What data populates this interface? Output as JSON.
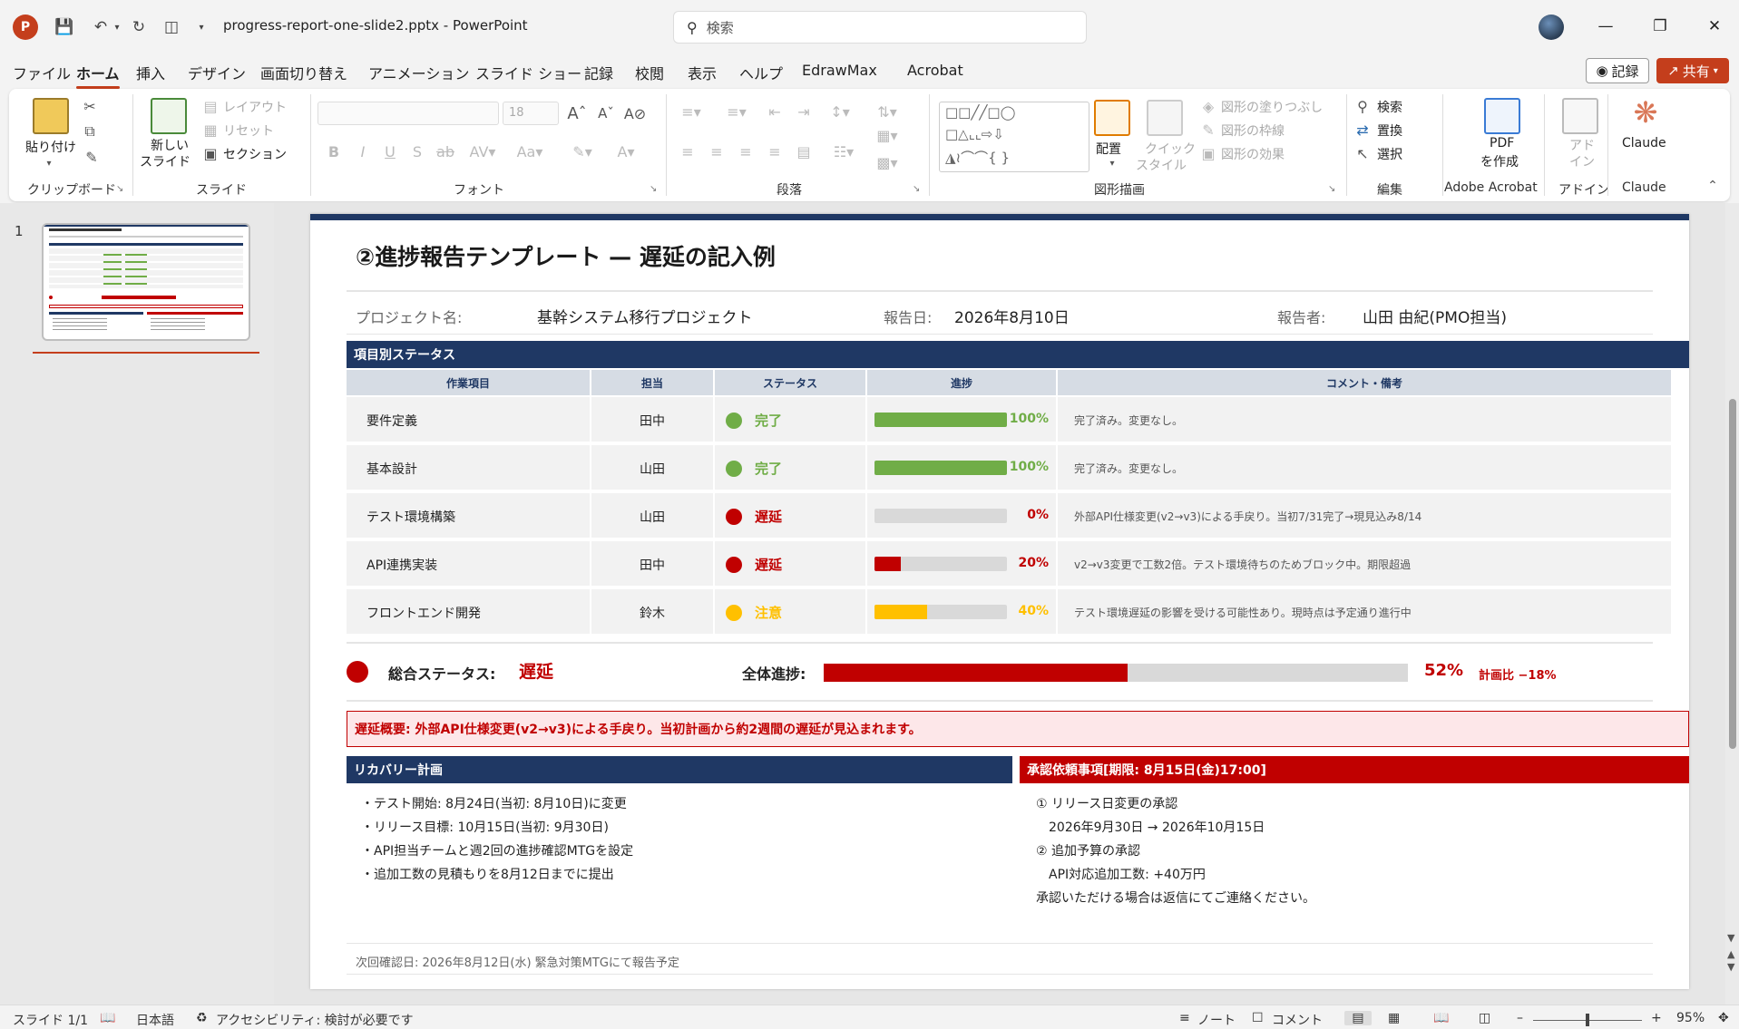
{
  "titlebar": {
    "app_logo": "P",
    "doc_title": "progress-report-one-slide2.pptx  -  PowerPoint",
    "search_placeholder": "検索"
  },
  "menu": {
    "items": [
      "ファイル",
      "ホーム",
      "挿入",
      "デザイン",
      "画面切り替え",
      "アニメーション",
      "スライド ショー",
      "記録",
      "校閲",
      "表示",
      "ヘルプ",
      "EdrawMax",
      "Acrobat"
    ],
    "active": "ホーム",
    "record_btn": "記録",
    "share_btn": "共有"
  },
  "ribbon": {
    "groups": [
      "クリップボード",
      "スライド",
      "フォント",
      "段落",
      "図形描画",
      "編集",
      "Adobe Acrobat",
      "アドイン",
      "Claude"
    ],
    "paste": "貼り付け",
    "new_slide_1": "新しい",
    "new_slide_2": "スライド",
    "layout": "レイアウト",
    "reset": "リセット",
    "section": "セクション",
    "font_size": "18",
    "arrange": "配置",
    "quick_style_1": "クイック",
    "quick_style_2": "スタイル",
    "shape_fill": "図形の塗りつぶし",
    "shape_outline": "図形の枠線",
    "shape_effect": "図形の効果",
    "find": "検索",
    "replace": "置換",
    "select": "選択",
    "pdf_1": "PDF",
    "pdf_2": "を作成",
    "addin_1": "アド",
    "addin_2": "イン",
    "claude": "Claude"
  },
  "thumb": {
    "number": "1"
  },
  "slide": {
    "title": "②進捗報告テンプレート — 遅延の記入例",
    "info": {
      "project_label": "プロジェクト名:",
      "project_value": "基幹システム移行プロジェクト",
      "date_label": "報告日:",
      "date_value": "2026年8月10日",
      "reporter_label": "報告者:",
      "reporter_value": "山田 由紀(PMO担当)"
    },
    "status_section": "項目別ステータス",
    "columns": [
      "作業項目",
      "担当",
      "ステータス",
      "進捗",
      "コメント・備考"
    ],
    "rows": [
      {
        "task": "要件定義",
        "owner": "田中",
        "status": "完了",
        "status_color": "#70ad47",
        "progress": 100,
        "progress_text": "100%",
        "bar_color": "#70ad47",
        "comment": "完了済み。変更なし。"
      },
      {
        "task": "基本設計",
        "owner": "山田",
        "status": "完了",
        "status_color": "#70ad47",
        "progress": 100,
        "progress_text": "100%",
        "bar_color": "#70ad47",
        "comment": "完了済み。変更なし。"
      },
      {
        "task": "テスト環境構築",
        "owner": "山田",
        "status": "遅延",
        "status_color": "#c00000",
        "progress": 0,
        "progress_text": "0%",
        "bar_color": "#c00000",
        "comment": "外部API仕様変更(v2→v3)による手戻り。当初7/31完了→現見込み8/14"
      },
      {
        "task": "API連携実装",
        "owner": "田中",
        "status": "遅延",
        "status_color": "#c00000",
        "progress": 20,
        "progress_text": "20%",
        "bar_color": "#c00000",
        "comment": "v2→v3変更で工数2倍。テスト環境待ちのためブロック中。期限超過"
      },
      {
        "task": "フロントエンド開発",
        "owner": "鈴木",
        "status": "注意",
        "status_color": "#ffc000",
        "progress": 40,
        "progress_text": "40%",
        "bar_color": "#ffc000",
        "comment": "テスト環境遅延の影響を受ける可能性あり。現時点は予定通り進行中"
      }
    ],
    "overall": {
      "label": "総合ステータス:",
      "value": "遅延",
      "progress_label": "全体進捗:",
      "progress": 52,
      "progress_text": "52%",
      "delta": "計画比 −18%"
    },
    "delay_summary": "遅延概要: 外部API仕様変更(v2→v3)による手戻り。当初計画から約2週間の遅延が見込まれます。",
    "recovery": {
      "header": "リカバリー計画",
      "lines": [
        "・テスト開始: 8月24日(当初: 8月10日)に変更",
        "・リリース目標: 10月15日(当初: 9月30日)",
        "・API担当チームと週2回の進捗確認MTGを設定",
        "・追加工数の見積もりを8月12日までに提出"
      ]
    },
    "approval": {
      "header": "承認依頼事項[期限: 8月15日(金)17:00]",
      "lines": [
        "① リリース日変更の承認",
        "　2026年9月30日 → 2026年10月15日",
        "② 追加予算の承認",
        "　API対応追加工数: +40万円",
        "承認いただける場合は返信にてご連絡ください。"
      ]
    },
    "footnote": "次回確認日: 2026年8月12日(水)  緊急対策MTGにて報告予定"
  },
  "statusbar": {
    "slide": "スライド 1/1",
    "language": "日本語",
    "accessibility": "アクセシビリティ: 検討が必要です",
    "notes": "ノート",
    "comments": "コメント",
    "zoom": "95%"
  },
  "colors": {
    "navy": "#1f3864",
    "red": "#c00000",
    "green": "#70ad47",
    "amber": "#ffc000",
    "accent": "#c43e1c"
  }
}
